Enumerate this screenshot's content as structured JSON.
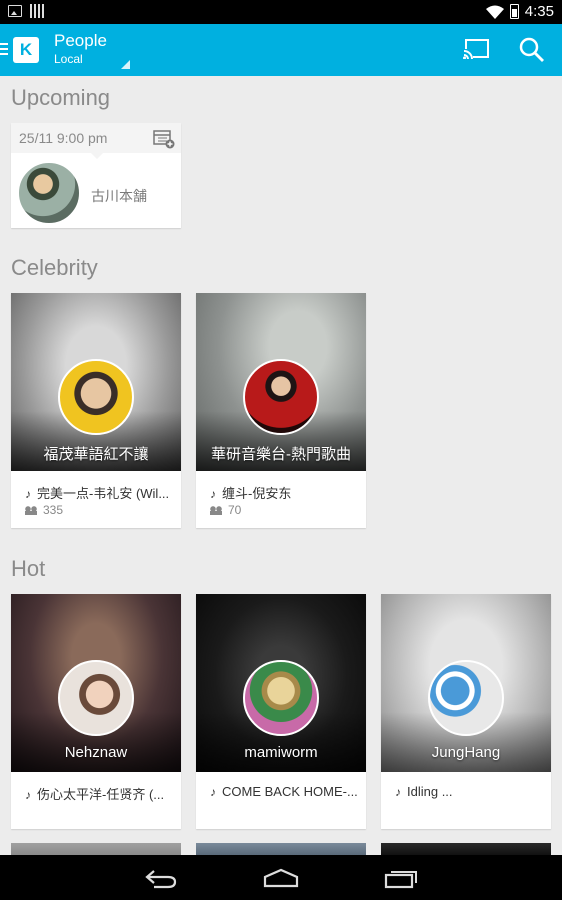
{
  "status_bar": {
    "time": "4:35"
  },
  "app_bar": {
    "title": "People",
    "subtitle": "Local",
    "logo_letter": "K"
  },
  "sections": {
    "upcoming": "Upcoming",
    "celebrity": "Celebrity",
    "hot": "Hot"
  },
  "upcoming": {
    "date": "25/11 9:00 pm",
    "name": "古川本舗"
  },
  "celebrity": [
    {
      "name": "福茂華語紅不讓",
      "song": "完美一点-韦礼安 (Wil...",
      "count": "335"
    },
    {
      "name": "華研音樂台-熱門歌曲",
      "song": "缠斗-倪安东",
      "count": "70"
    }
  ],
  "hot": [
    {
      "name": "Nehznaw",
      "song": "伤心太平洋-任贤齐 (..."
    },
    {
      "name": "mamiworm",
      "song": "COME BACK HOME-..."
    },
    {
      "name": "JungHang",
      "song": "Idling ..."
    }
  ],
  "icons": {
    "menu": "menu-icon",
    "cast": "cast-icon",
    "search": "search-icon",
    "calendar_add": "calendar-add-icon",
    "music_note": "music-note-icon",
    "listeners": "people-icon"
  },
  "colors": {
    "accent": "#00b0e0",
    "background": "#ececec"
  }
}
